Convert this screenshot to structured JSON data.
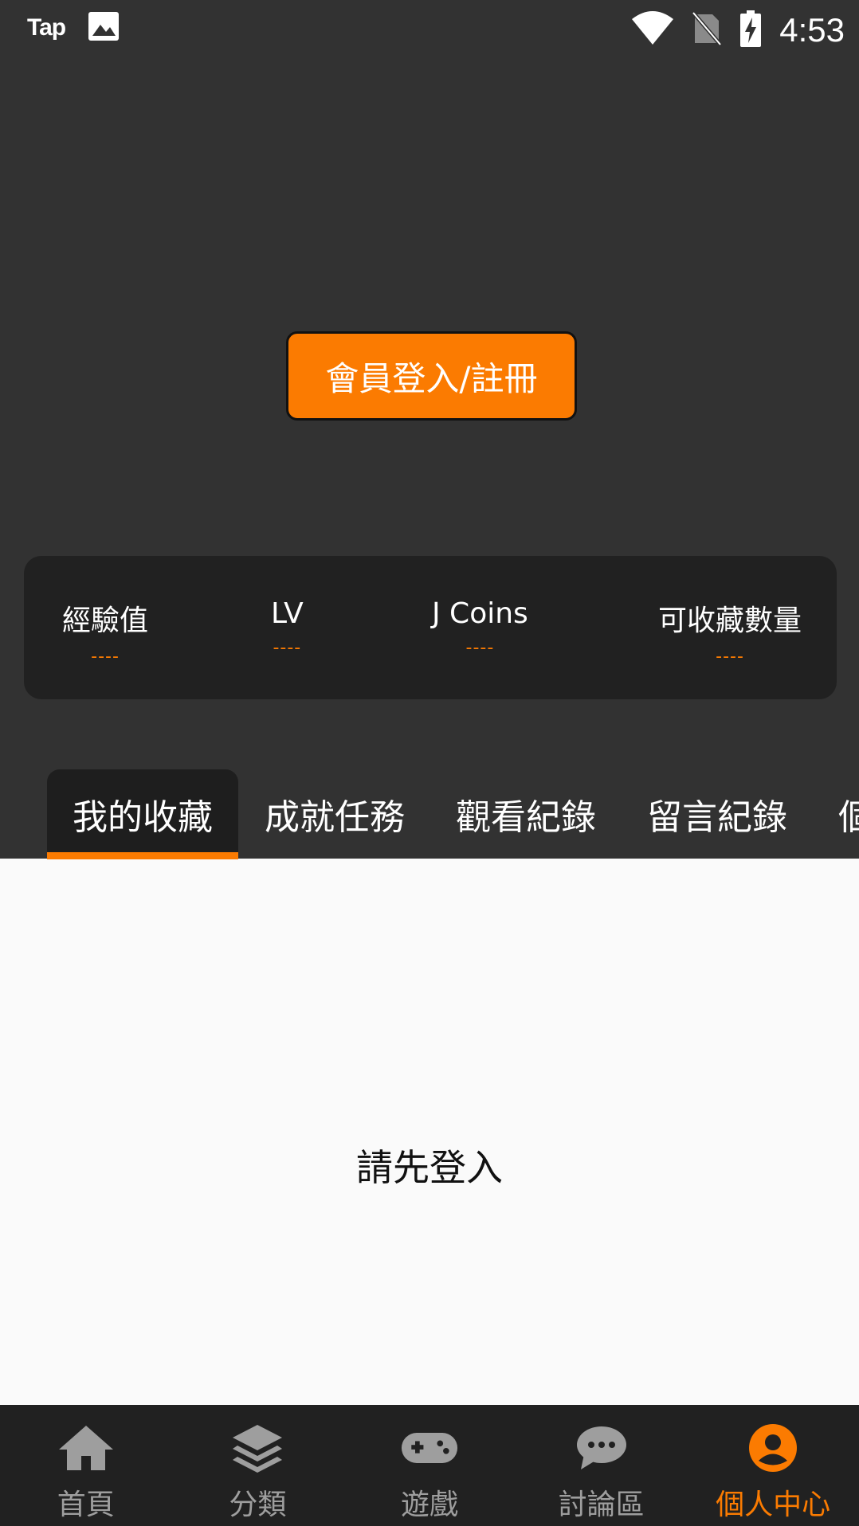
{
  "status_bar": {
    "app_label": "Tap",
    "time": "4:53",
    "icons": [
      "image-icon",
      "wifi-icon",
      "no-sim-icon",
      "battery-charging-icon"
    ]
  },
  "profile": {
    "login_button_label": "會員登入/註冊"
  },
  "stats": [
    {
      "label": "經驗值",
      "value": "----"
    },
    {
      "label": "LV",
      "value": "----"
    },
    {
      "label": "J Coins",
      "value": "----"
    },
    {
      "label": "可收藏數量",
      "value": "----"
    }
  ],
  "tabs": [
    {
      "label": "我的收藏",
      "active": true
    },
    {
      "label": "成就任務",
      "active": false
    },
    {
      "label": "觀看紀錄",
      "active": false
    },
    {
      "label": "留言紀錄",
      "active": false
    },
    {
      "label": "個",
      "active": false
    }
  ],
  "content": {
    "empty_message": "請先登入"
  },
  "bottom_nav": [
    {
      "label": "首頁",
      "icon": "home-icon",
      "active": false
    },
    {
      "label": "分類",
      "icon": "layers-icon",
      "active": false
    },
    {
      "label": "遊戲",
      "icon": "gamepad-icon",
      "active": false
    },
    {
      "label": "討論區",
      "icon": "chat-bubble-icon",
      "active": false
    },
    {
      "label": "個人中心",
      "icon": "account-circle-icon",
      "active": true
    }
  ],
  "colors": {
    "accent": "#fb7b01",
    "background_dark": "#323232",
    "card_dark": "#212121",
    "content_background": "#fafafa",
    "nav_inactive": "#9e9e9e"
  }
}
